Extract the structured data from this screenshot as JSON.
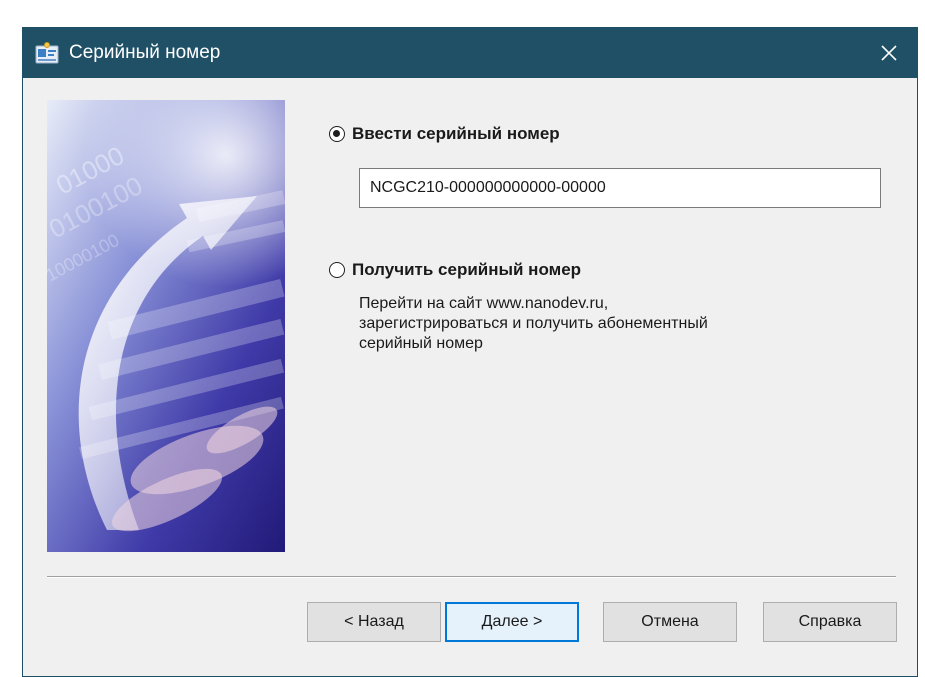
{
  "window": {
    "title": "Серийный номер",
    "title_bar_color": "#1f5066"
  },
  "options": {
    "enter_serial": {
      "label": "Ввести серийный номер",
      "selected": true
    },
    "get_serial": {
      "label": "Получить серийный номер",
      "selected": false,
      "description_line1": "Перейти на сайт www.nanodev.ru,",
      "description_line2": "зарегистрироваться и получить абонементный",
      "description_line3": "серийный номер"
    }
  },
  "serial_input": {
    "value": "NCGC210-000000000000-00000"
  },
  "buttons": {
    "back": "< Назад",
    "next": "Далее >",
    "cancel": "Отмена",
    "help": "Справка"
  },
  "icons": {
    "title": "serial-number-app-icon",
    "close": "close-icon"
  }
}
